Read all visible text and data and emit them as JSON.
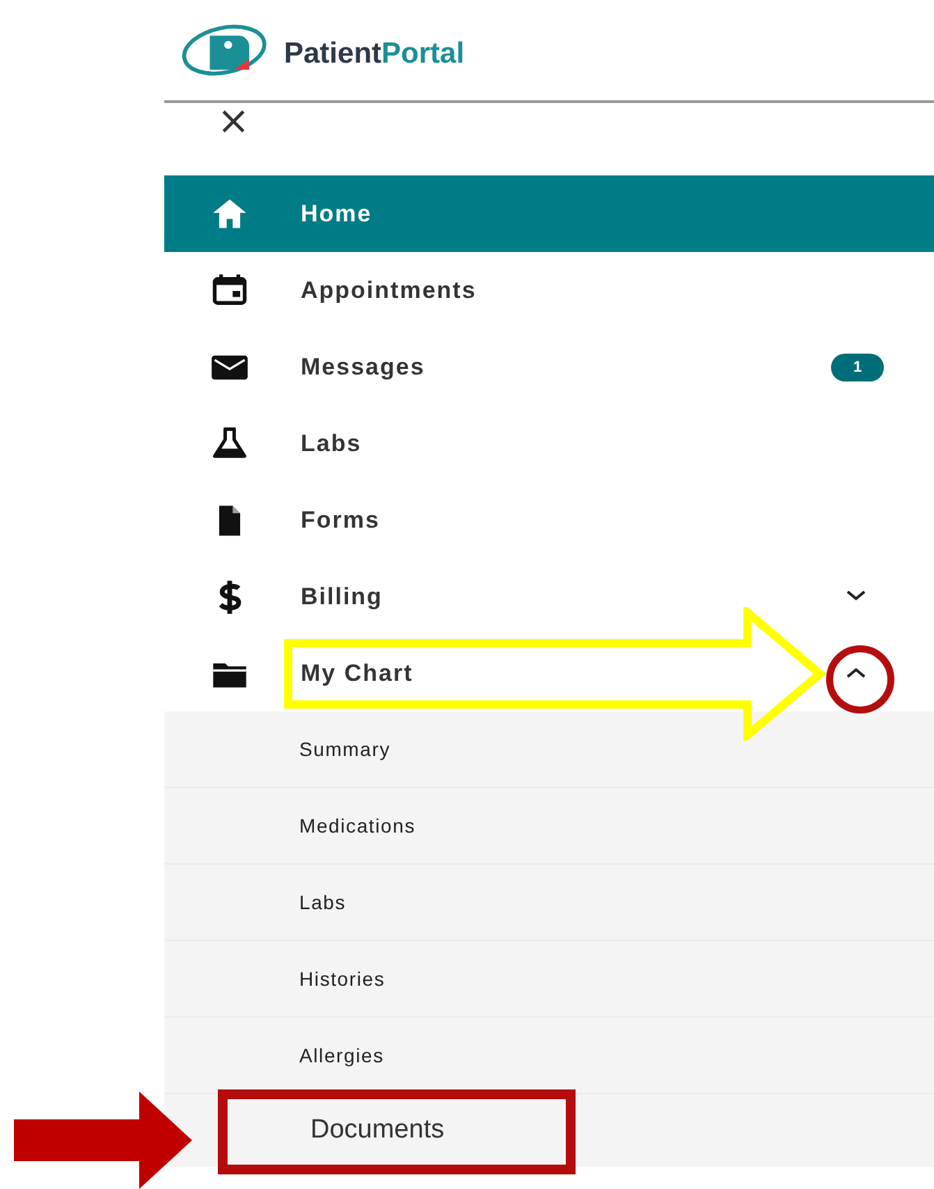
{
  "header": {
    "brand_dark": "Patient",
    "brand_accent": "Portal",
    "close": "×"
  },
  "menu": [
    {
      "label": "Home",
      "selected": true
    },
    {
      "label": "Appointments",
      "selected": false
    },
    {
      "label": "Messages",
      "selected": false,
      "badge": "1"
    },
    {
      "label": "Labs",
      "selected": false
    },
    {
      "label": "Forms",
      "selected": false
    },
    {
      "label": "Billing",
      "selected": false,
      "expanded": false
    },
    {
      "label": "My Chart",
      "selected": false,
      "expanded": true,
      "children": [
        {
          "label": "Summary"
        },
        {
          "label": "Medications"
        },
        {
          "label": "Labs"
        },
        {
          "label": "Histories"
        },
        {
          "label": "Allergies"
        },
        {
          "label": "Documents"
        }
      ]
    }
  ],
  "annotations": [
    {
      "kind": "outline-arrow"
    },
    {
      "kind": "circle"
    },
    {
      "kind": "box"
    },
    {
      "kind": "arrow"
    }
  ]
}
